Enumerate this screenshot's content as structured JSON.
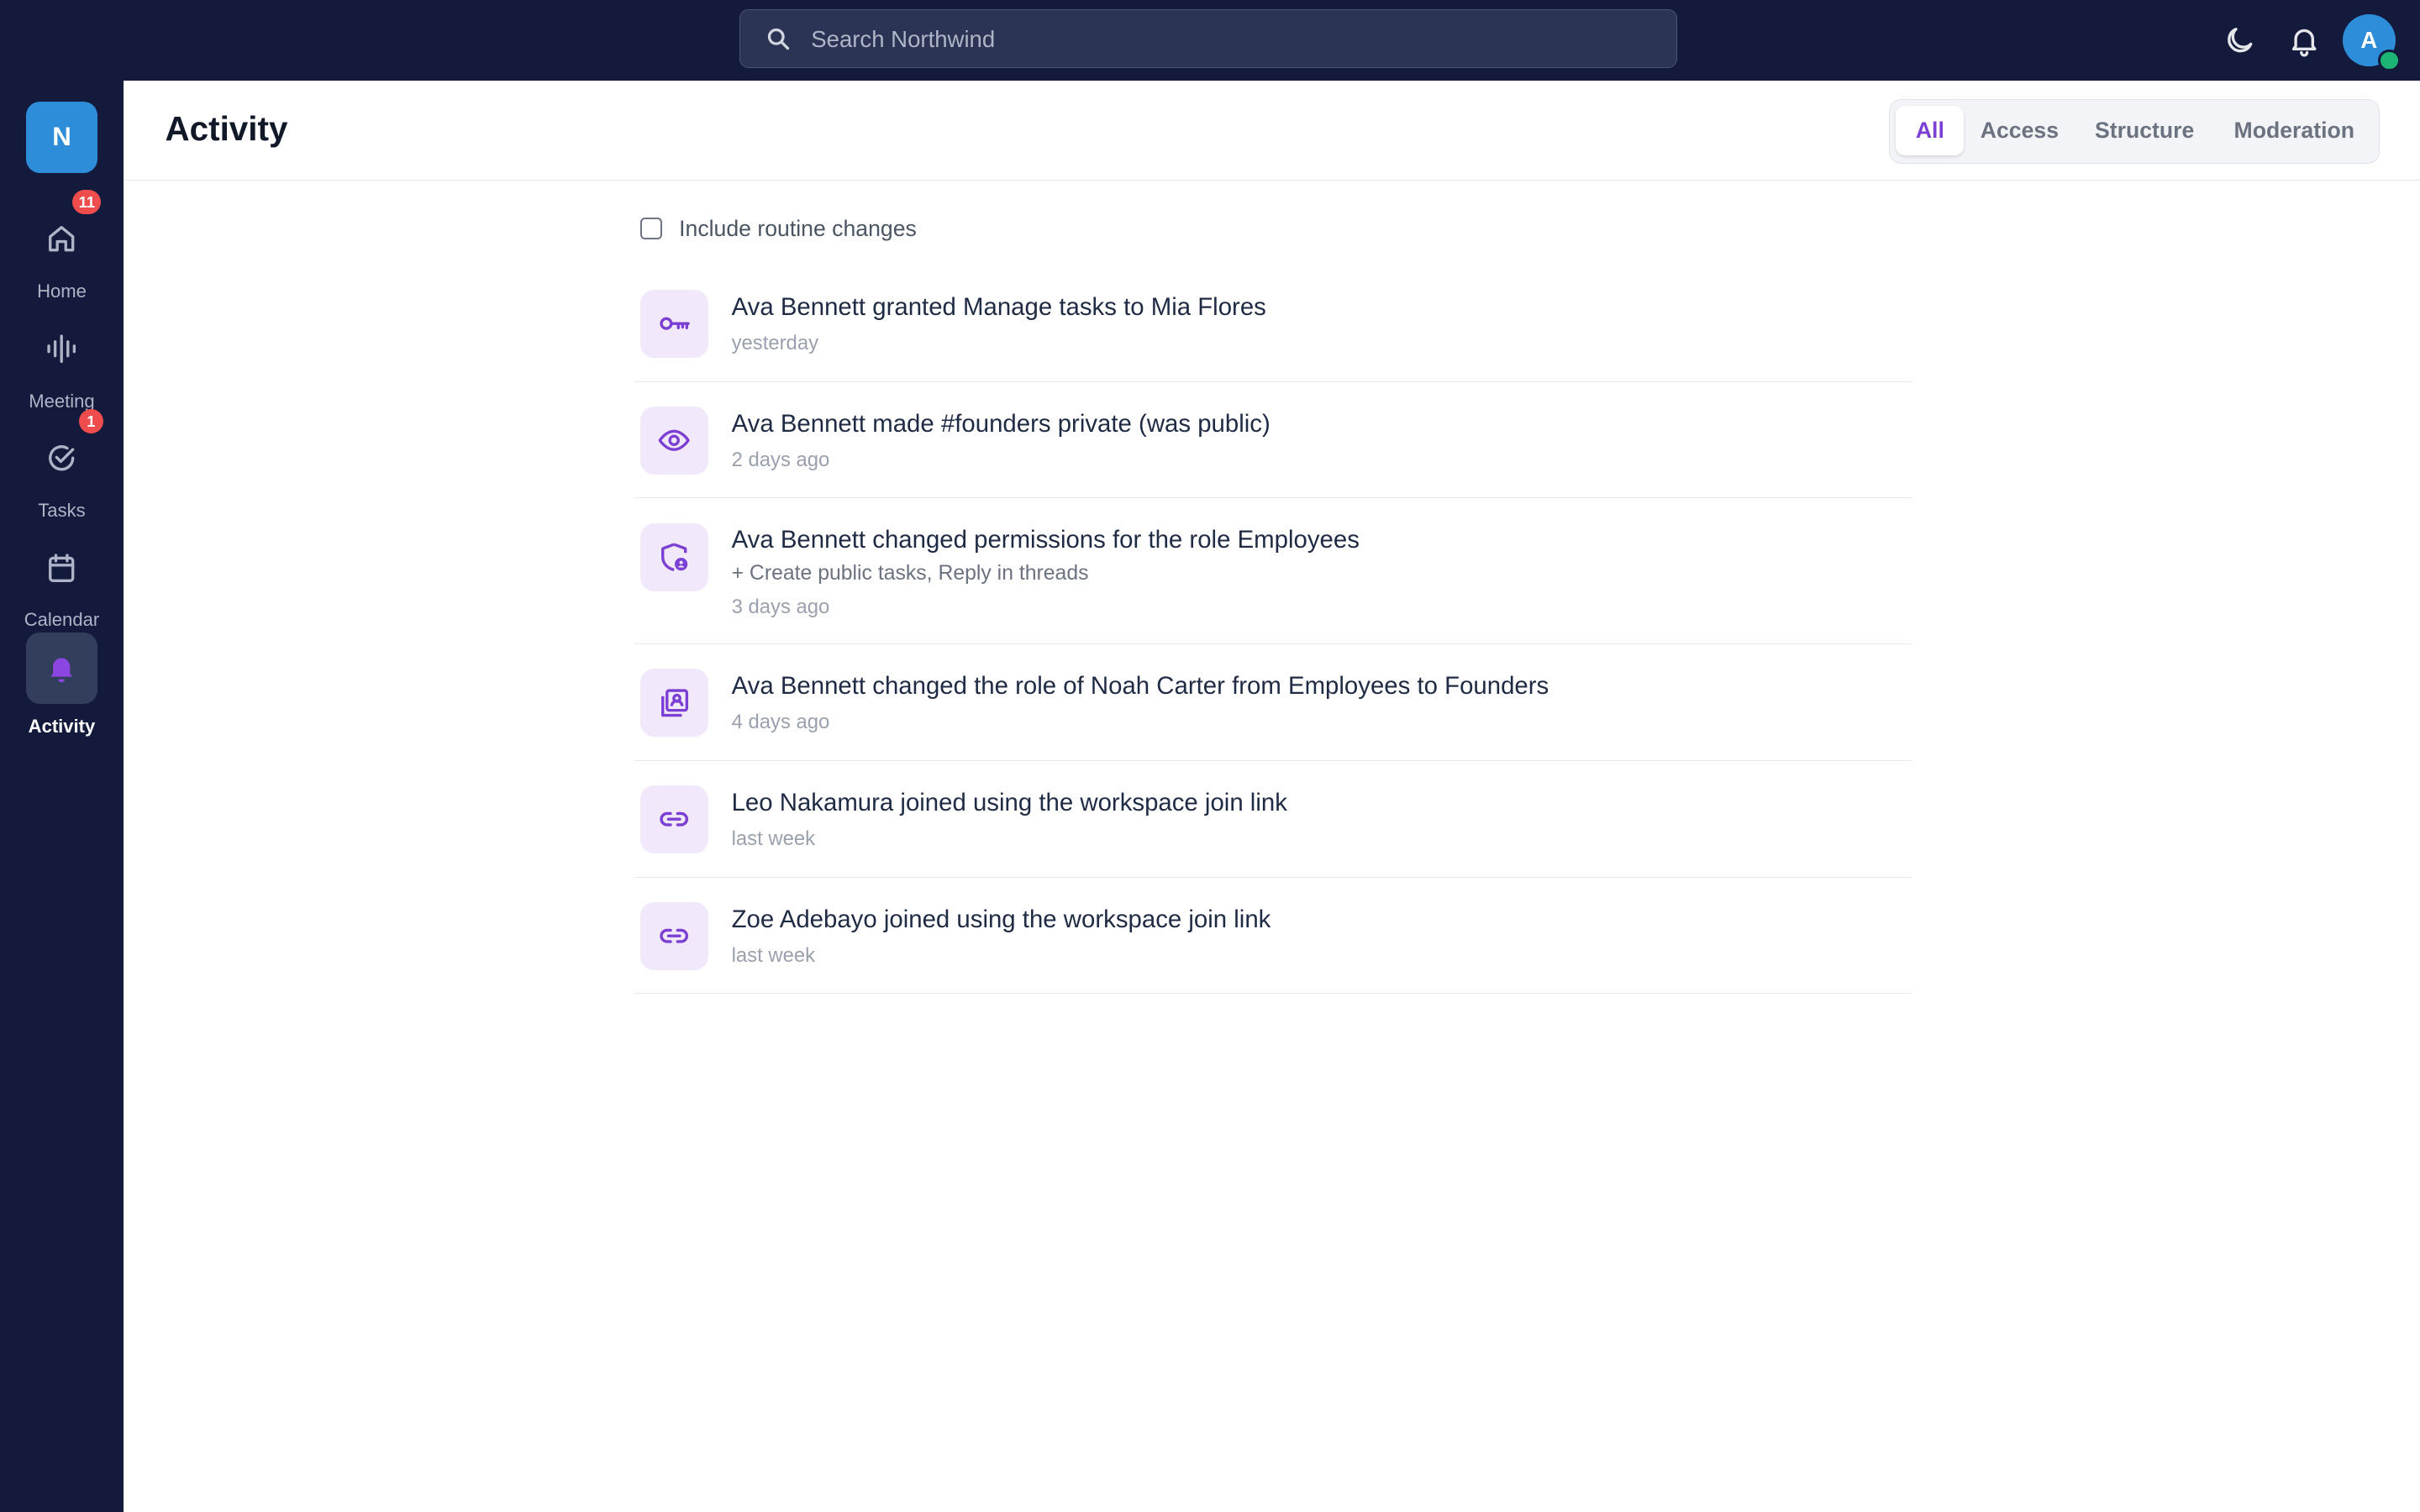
{
  "topbar": {
    "search_placeholder": "Search Northwind",
    "avatar_initial": "A"
  },
  "sidebar": {
    "workspace_initial": "N",
    "items": [
      {
        "label": "Home",
        "icon": "home-icon",
        "badge": "11"
      },
      {
        "label": "Meeting",
        "icon": "waveform-icon",
        "badge": ""
      },
      {
        "label": "Tasks",
        "icon": "check-circle-icon",
        "badge": "1"
      },
      {
        "label": "Calendar",
        "icon": "calendar-icon",
        "badge": ""
      },
      {
        "label": "Activity",
        "icon": "bell-icon",
        "badge": "",
        "active": true
      }
    ]
  },
  "header": {
    "title": "Activity",
    "tabs": [
      {
        "label": "All",
        "active": true
      },
      {
        "label": "Access"
      },
      {
        "label": "Structure"
      },
      {
        "label": "Moderation"
      }
    ]
  },
  "filter": {
    "label": "Include routine changes",
    "checked": false
  },
  "activity": [
    {
      "icon": "key-icon",
      "text": "Ava Bennett granted Manage tasks to Mia Flores",
      "time": "yesterday"
    },
    {
      "icon": "eye-icon",
      "text": "Ava Bennett made #founders private (was public)",
      "time": "2 days ago"
    },
    {
      "icon": "shield-user-icon",
      "text": "Ava Bennett changed permissions for the role Employees",
      "detail": "+ Create public tasks, Reply in threads",
      "time": "3 days ago"
    },
    {
      "icon": "user-badge-icon",
      "text": "Ava Bennett changed the role of Noah Carter from Employees to Founders",
      "time": "4 days ago"
    },
    {
      "icon": "link-icon",
      "text": "Leo Nakamura joined using the workspace join link",
      "time": "last week"
    },
    {
      "icon": "link-icon",
      "text": "Zoe Adebayo joined using the workspace join link",
      "time": "last week"
    }
  ],
  "colors": {
    "nav_bg": "#131a3c",
    "accent": "#7b3fd3",
    "brand_blue": "#2d8dd8",
    "badge_red": "#ef4d4d"
  }
}
